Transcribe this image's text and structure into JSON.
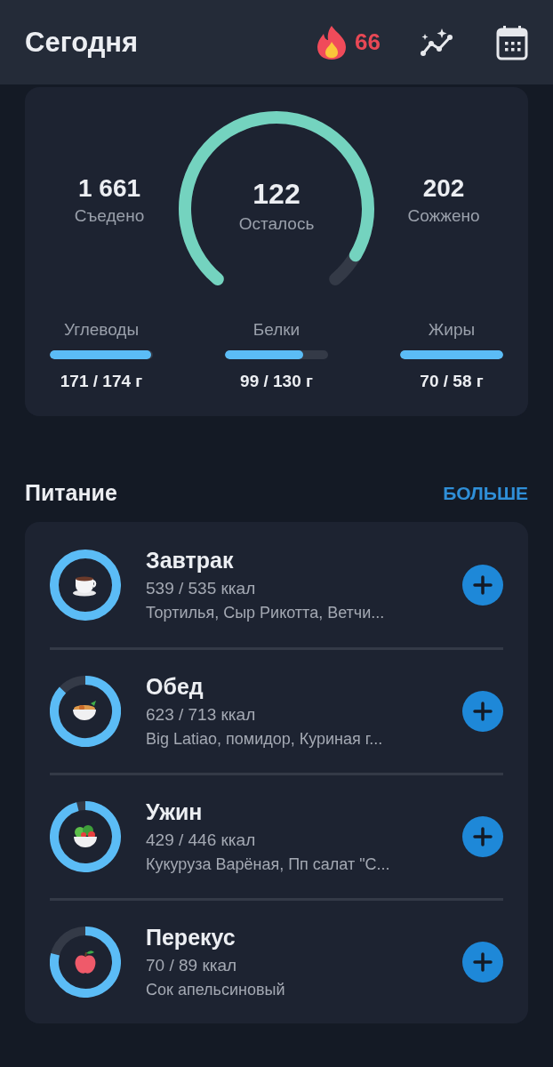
{
  "header": {
    "title": "Сегодня",
    "streak": "66"
  },
  "summary": {
    "eaten": {
      "value": "1 661",
      "label": "Съедено"
    },
    "remaining": {
      "value": "122",
      "label": "Осталось"
    },
    "burned": {
      "value": "202",
      "label": "Сожжено"
    },
    "macros": [
      {
        "name": "Углеводы",
        "level": 0.98,
        "reading": "171 / 174 г"
      },
      {
        "name": "Белки",
        "level": 0.76,
        "reading": "99 / 130 г"
      },
      {
        "name": "Жиры",
        "level": 1,
        "reading": "70 / 58 г"
      }
    ]
  },
  "nutrition": {
    "title": "Питание",
    "more": "БОЛЬШЕ",
    "meals": [
      {
        "kind": "breakfast",
        "name": "Завтрак",
        "calories": "539 / 535 ккал",
        "foods": "Тортилья, Сыр Рикотта, Ветчи..."
      },
      {
        "kind": "lunch",
        "name": "Обед",
        "calories": "623 / 713 ккал",
        "foods": "Big Latiao, помидор, Куриная г..."
      },
      {
        "kind": "dinner",
        "name": "Ужин",
        "calories": "429 / 446 ккал",
        "foods": "Кукуруза Варёная, Пп салат \"С..."
      },
      {
        "kind": "snack",
        "name": "Перекус",
        "calories": "70 / 89 ккал",
        "foods": "Сок апельсиновый"
      }
    ]
  }
}
